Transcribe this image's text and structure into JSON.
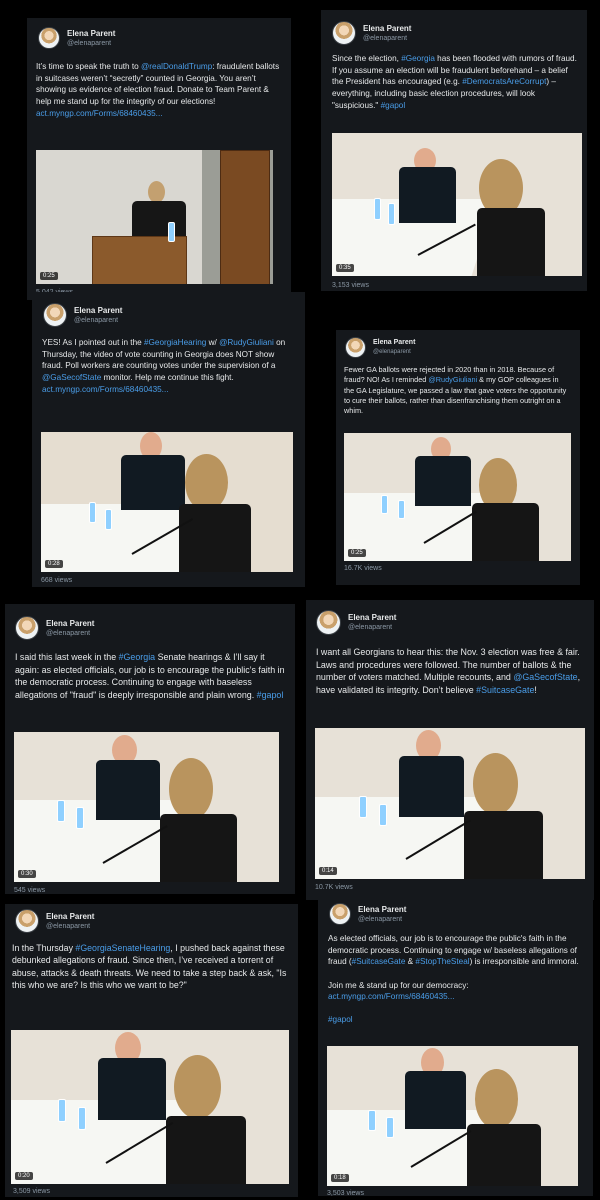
{
  "profile": {
    "name": "Elena Parent",
    "handle": "@elenaparent"
  },
  "tweets": [
    {
      "text": [
        {
          "t": "It’s time to speak the truth to "
        },
        {
          "t": "@realDonaldTrump",
          "h": true
        },
        {
          "t": ": fraudulent ballots in suitcases weren’t “secretly” counted in Georgia. You aren’t showing us evidence of election fraud. Donate to Team Parent & help me stand up for the integrity of our elections! "
        },
        {
          "t": "act.myngp.com/Forms/68460435...",
          "h": true
        }
      ],
      "time": "0:25",
      "views": "5,042 views"
    },
    {
      "text": [
        {
          "t": "Since the election, "
        },
        {
          "t": "#Georgia",
          "h": true
        },
        {
          "t": " has been flooded with rumors of fraud. If you assume an election will be fraudulent beforehand – a belief the President has encouraged (e.g. "
        },
        {
          "t": "#DemocratsAreCorrupt",
          "h": true
        },
        {
          "t": ") – everything, including basic election procedures, will look \"suspicious.\" "
        },
        {
          "t": "#gapol",
          "h": true
        }
      ],
      "time": "0:35",
      "views": "3,153 views"
    },
    {
      "text": [
        {
          "t": "YES! As I pointed out in the "
        },
        {
          "t": "#GeorgiaHearing",
          "h": true
        },
        {
          "t": " w/ "
        },
        {
          "t": "@RudyGiuliani",
          "h": true
        },
        {
          "t": " on Thursday, the video of vote counting in Georgia does NOT show fraud. Poll workers are counting votes under the supervision of a "
        },
        {
          "t": "@GaSecofState",
          "h": true
        },
        {
          "t": " monitor. Help me continue this fight. "
        },
        {
          "t": "act.myngp.com/Forms/68460435...",
          "h": true
        }
      ],
      "time": "0:28",
      "views": "668 views"
    },
    {
      "text": [
        {
          "t": "Fewer GA ballots were rejected in 2020 than in 2018. Because of fraud? NO! As I reminded "
        },
        {
          "t": "@RudyGiuliani",
          "h": true
        },
        {
          "t": " & my GOP colleagues in the GA Legislature, we passed a law that gave voters the opportunity to cure their ballots, rather than disenfranchising them outright on a whim."
        }
      ],
      "time": "0:25",
      "views": "16.7K views"
    },
    {
      "text": [
        {
          "t": "I said this last week in the "
        },
        {
          "t": "#Georgia",
          "h": true
        },
        {
          "t": " Senate hearings & I’ll say it again: as elected officials, our job is to encourage the public’s faith in the democratic process. Continuing to engage with baseless allegations of \"fraud\" is deeply irresponsible and plain wrong. "
        },
        {
          "t": "#gapol",
          "h": true
        }
      ],
      "time": "0:30",
      "views": "545 views"
    },
    {
      "text": [
        {
          "t": "I want all Georgians to hear this: the Nov. 3 election was free & fair. Laws and procedures were followed. The number of ballots & the number of voters matched. Multiple recounts, and "
        },
        {
          "t": "@GaSecofState",
          "h": true
        },
        {
          "t": ", have validated its integrity. Don’t believe "
        },
        {
          "t": "#SuitcaseGate",
          "h": true
        },
        {
          "t": "!"
        }
      ],
      "time": "0:14",
      "views": "10.7K views"
    },
    {
      "text": [
        {
          "t": "In the Thursday "
        },
        {
          "t": "#GeorgiaSenateHearing",
          "h": true
        },
        {
          "t": ", I pushed back against these debunked allegations of fraud. Since then, I’ve received a torrent of abuse, attacks & death threats. We need to take a step back & ask, \"Is this who we are? Is this who we want to be?\""
        }
      ],
      "time": "0:20",
      "views": "3,509 views"
    },
    {
      "text": [
        {
          "t": "As elected officials, our job is to encourage the public's faith in the democratic process. Continuing to engage w/ baseless allegations of fraud ("
        },
        {
          "t": "#SuitcaseGate",
          "h": true
        },
        {
          "t": " & "
        },
        {
          "t": "#StopTheSteal",
          "h": true
        },
        {
          "t": ") is irresponsible and immoral.\n\nJoin me & stand up for our democracy: "
        },
        {
          "t": "act.myngp.com/Forms/68460435...",
          "h": true
        },
        {
          "t": "\n\n"
        },
        {
          "t": "#gapol",
          "h": true
        }
      ],
      "time": "0:18",
      "views": "3,503 views"
    }
  ]
}
